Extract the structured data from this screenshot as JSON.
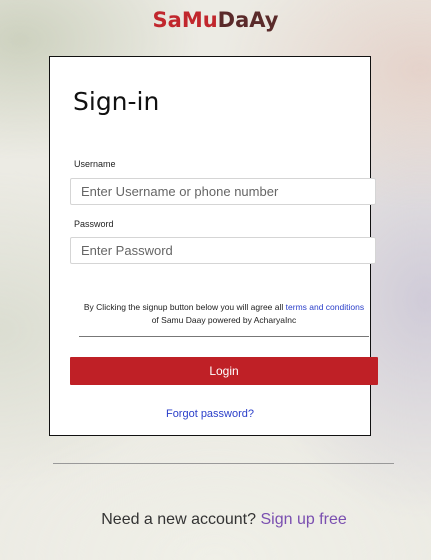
{
  "brand": {
    "logo_parts": [
      "Sa",
      "Mu",
      "Da",
      "Ay"
    ],
    "colors": {
      "red": "#c1272d",
      "dark": "#5a2a2a"
    }
  },
  "form": {
    "title": "Sign-in",
    "username": {
      "label": "Username",
      "placeholder": "Enter Username or phone number",
      "value": ""
    },
    "password": {
      "label": "Password",
      "placeholder": "Enter Password",
      "value": ""
    },
    "notice": {
      "prefix": "By Clicking the signup button below you will agree all",
      "link": "terms and conditions",
      "suffix": "of Samu Daay powered by AcharyaInc"
    },
    "login_label": "Login",
    "forgot_label": "Forgot password?"
  },
  "footer": {
    "prompt": "Need a new account?",
    "signup_link": "Sign up free"
  },
  "colors": {
    "primary_button": "#bf2026",
    "link": "#2a3ec9",
    "signup_link": "#7a4fb0"
  }
}
